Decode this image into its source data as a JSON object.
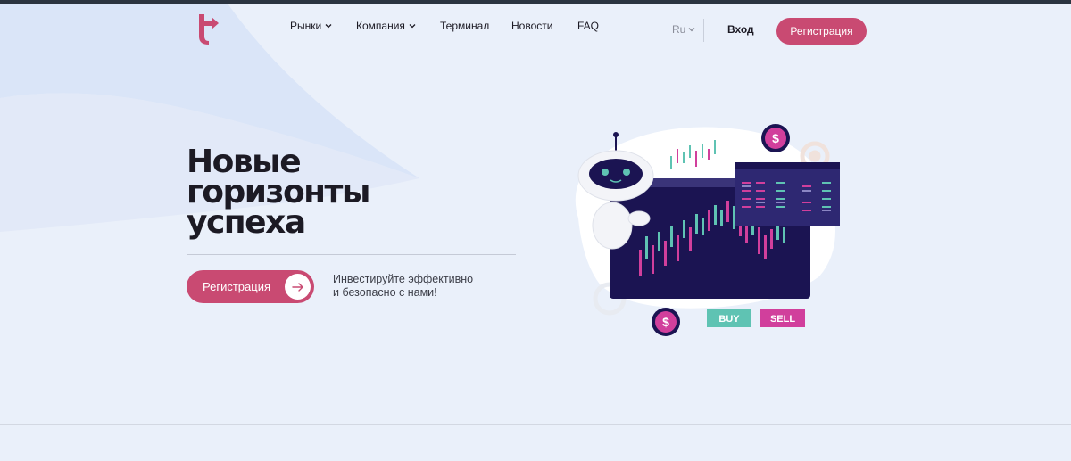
{
  "header": {
    "nav": [
      {
        "label": "Рынки",
        "has_dropdown": true
      },
      {
        "label": "Компания",
        "has_dropdown": true
      },
      {
        "label": "Терминал",
        "has_dropdown": false
      },
      {
        "label": "Новости",
        "has_dropdown": false
      },
      {
        "label": "FAQ",
        "has_dropdown": false
      }
    ],
    "lang": "Ru",
    "login_label": "Вход",
    "register_label": "Регистрация"
  },
  "hero": {
    "title_lines": [
      "Новые",
      "горизонты",
      "успеха"
    ],
    "cta_label": "Регистрация",
    "subtitle_lines": [
      "Инвестируйте эффективно",
      "и безопасно с нами!"
    ]
  },
  "illustration": {
    "buy_label": "BUY",
    "sell_label": "SELL",
    "dollar_symbol": "$"
  },
  "colors": {
    "brand_pink": "#c94a72",
    "dark_navy": "#1b1452",
    "teal": "#5fc3b3",
    "magenta": "#d13f9c",
    "background": "#eaf0fa"
  },
  "icons": [
    "logo-icon",
    "chevron-down-icon",
    "arrow-right-icon",
    "robot-icon",
    "dollar-coin-icon",
    "gear-icon"
  ]
}
